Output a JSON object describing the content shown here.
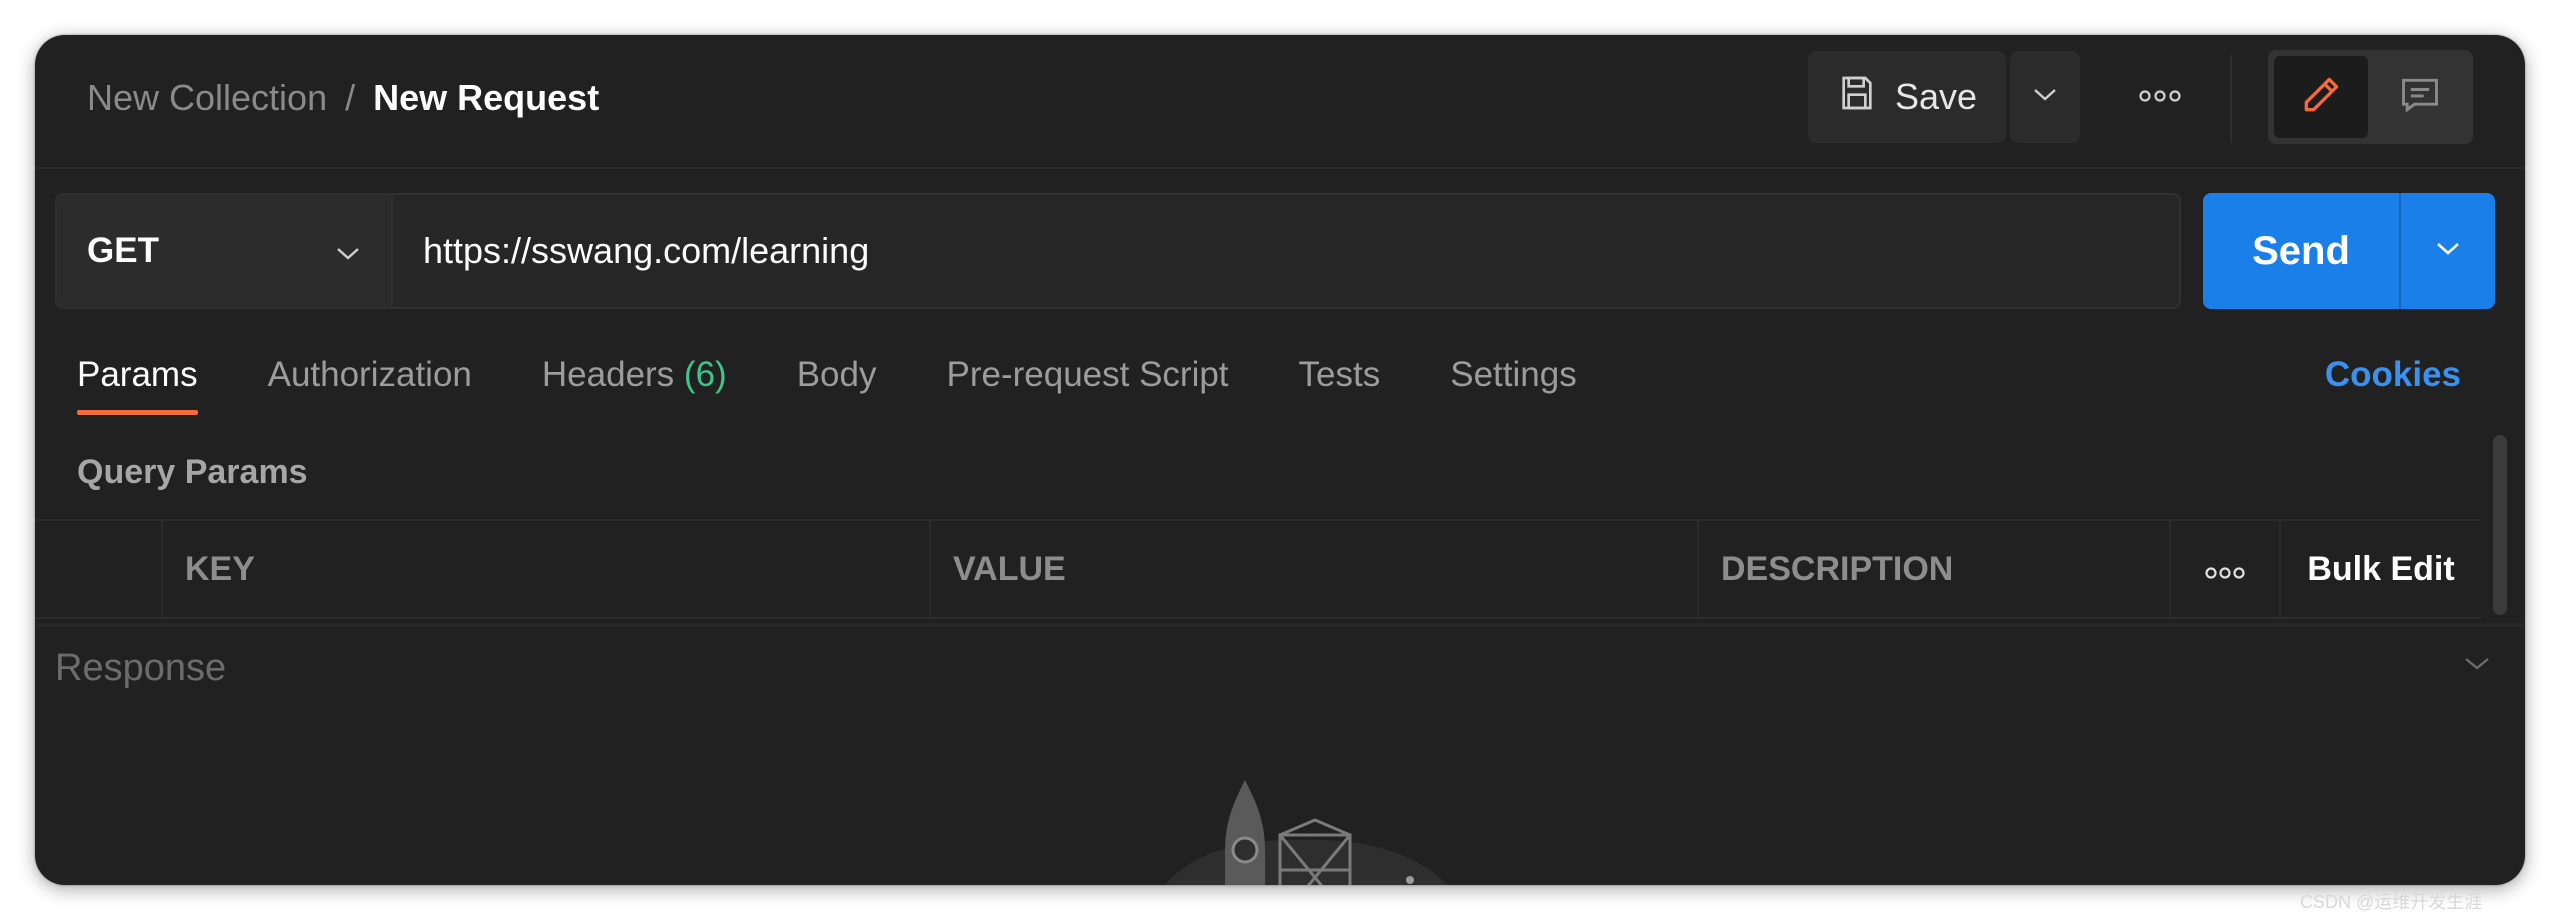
{
  "header": {
    "breadcrumb_collection": "New Collection",
    "breadcrumb_separator": "/",
    "breadcrumb_request": "New Request",
    "save_label": "Save"
  },
  "request": {
    "method": "GET",
    "url": "https://sswang.com/learning",
    "send_label": "Send"
  },
  "tabs": [
    {
      "label": "Params",
      "active": true
    },
    {
      "label": "Authorization"
    },
    {
      "label": "Headers ",
      "count": "(6)"
    },
    {
      "label": "Body"
    },
    {
      "label": "Pre-request Script"
    },
    {
      "label": "Tests"
    },
    {
      "label": "Settings"
    }
  ],
  "cookies_label": "Cookies",
  "query_params": {
    "title": "Query Params",
    "columns": [
      "KEY",
      "VALUE",
      "DESCRIPTION"
    ],
    "bulk_edit_label": "Bulk Edit"
  },
  "response": {
    "title": "Response"
  },
  "watermark": "CSDN @运维开发生涯",
  "colors": {
    "background": "#212121",
    "accent_tab": "#f26b3a",
    "send_button": "#1a7fe8",
    "cookies_link": "#3b92ee",
    "headers_count": "#3fc48a"
  },
  "icons": [
    "save-icon",
    "chevron-down-icon",
    "more-icon",
    "pencil-icon",
    "comment-icon",
    "rocket-illustration"
  ]
}
